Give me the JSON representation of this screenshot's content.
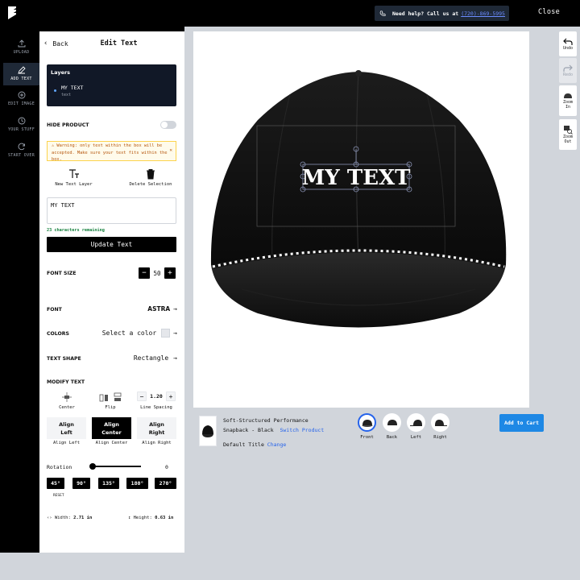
{
  "header": {
    "help_text": "Need help? Call us at",
    "phone": "(720)-869-5995",
    "close_label": "Close"
  },
  "rail": {
    "items": [
      {
        "label": "UPLOAD"
      },
      {
        "label": "ADD TEXT"
      },
      {
        "label": "EDIT IMAGE"
      },
      {
        "label": "YOUR STUFF"
      },
      {
        "label": "START OVER"
      }
    ]
  },
  "panel": {
    "back_label": "Back",
    "title": "Edit Text",
    "layers": {
      "title": "Layers",
      "item_name": "MY TEXT",
      "item_type": "text"
    },
    "hide_product_label": "HIDE PRODUCT",
    "warning": "Warning: only text within the box will be accepted. Make sure your text fits within the box.",
    "new_layer_label": "New Text Layer",
    "delete_label": "Delete Selection",
    "text_value": "MY TEXT",
    "remaining": "23 characters remaining",
    "update_label": "Update Text",
    "font_size_label": "FONT SIZE",
    "font_size_value": "50",
    "font_label": "FONT",
    "font_value": "ASTRA",
    "colors_label": "COLORS",
    "colors_value": "Select a color",
    "shape_label": "TEXT SHAPE",
    "shape_value": "Rectangle",
    "modify_label": "MODIFY TEXT",
    "center_label": "Center",
    "flip_label": "Flip",
    "line_spacing_label": "Line Spacing",
    "line_spacing_value": "1.20",
    "align": [
      {
        "line1": "Align",
        "line2": "Left",
        "caption": "Align Left"
      },
      {
        "line1": "Align",
        "line2": "Center",
        "caption": "Align Center"
      },
      {
        "line1": "Align",
        "line2": "Right",
        "caption": "Align Right"
      }
    ],
    "rotation_label": "Rotation",
    "rotation_value": "0",
    "rotation_buttons": [
      "45°",
      "90°",
      "135°",
      "180°",
      "270°"
    ],
    "reset_label": "RESET",
    "width_label": "Width:",
    "width_value": "2.71 in",
    "height_label": "Height:",
    "height_value": "0.63 in"
  },
  "canvas": {
    "design_text": "MY TEXT"
  },
  "side_tools": {
    "undo": "Undo",
    "redo": "Redo",
    "zoom_in_1": "Zoom",
    "zoom_in_2": "In",
    "zoom_out_1": "Zoom",
    "zoom_out_2": "Out"
  },
  "product": {
    "name_line1": "Soft-Structured Performance",
    "name_line2": "Snapback - Black",
    "switch_label": "Switch Product",
    "title_label": "Default Title",
    "change_label": "Change",
    "views": [
      "Front",
      "Back",
      "Left",
      "Right"
    ],
    "cart_label": "Add to Cart"
  },
  "colors": {
    "accent": "#1e88e5",
    "warning_text": "#b45309",
    "remaining_text": "#15803d"
  }
}
